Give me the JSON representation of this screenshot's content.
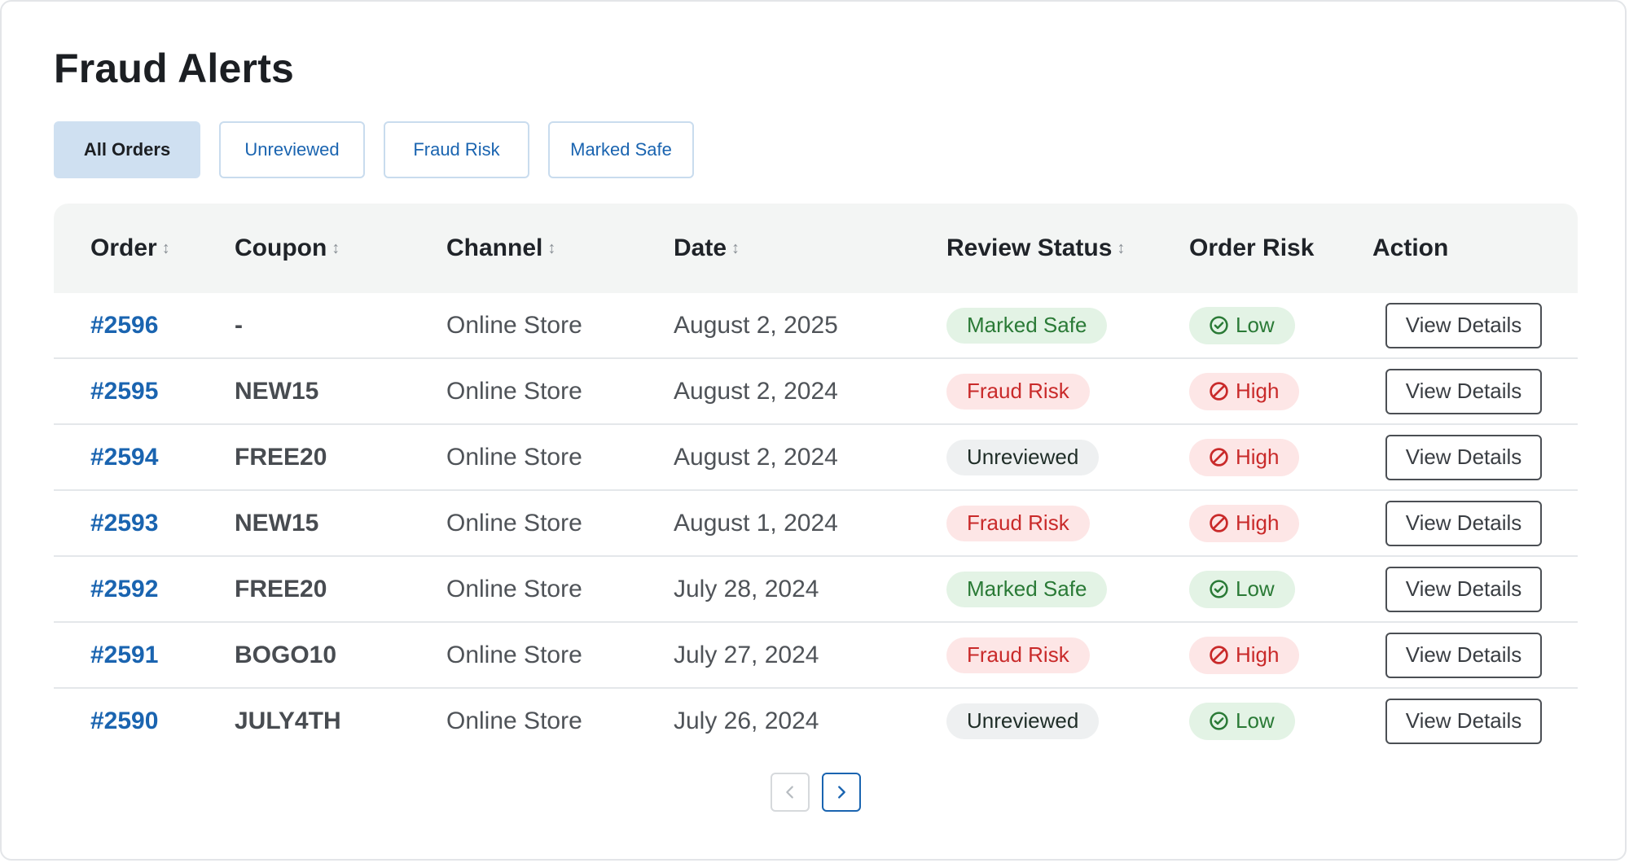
{
  "title": "Fraud Alerts",
  "tabs": [
    {
      "label": "All Orders",
      "active": true
    },
    {
      "label": "Unreviewed",
      "active": false
    },
    {
      "label": "Fraud Risk",
      "active": false
    },
    {
      "label": "Marked Safe",
      "active": false
    }
  ],
  "table": {
    "columns": [
      "Order",
      "Coupon",
      "Channel",
      "Date",
      "Review Status",
      "Order Risk",
      "Action"
    ],
    "sort_icon": "↕",
    "rows": [
      {
        "order": "#2596",
        "coupon": "-",
        "channel": "Online Store",
        "date": "August 2, 2025",
        "status": "Marked Safe",
        "risk": "Low",
        "action": "View Details"
      },
      {
        "order": "#2595",
        "coupon": "NEW15",
        "channel": "Online Store",
        "date": "August 2, 2024",
        "status": "Fraud Risk",
        "risk": "High",
        "action": "View Details"
      },
      {
        "order": "#2594",
        "coupon": "FREE20",
        "channel": "Online Store",
        "date": "August 2, 2024",
        "status": "Unreviewed",
        "risk": "High",
        "action": "View Details"
      },
      {
        "order": "#2593",
        "coupon": "NEW15",
        "channel": "Online Store",
        "date": "August 1, 2024",
        "status": "Fraud Risk",
        "risk": "High",
        "action": "View Details"
      },
      {
        "order": "#2592",
        "coupon": "FREE20",
        "channel": "Online Store",
        "date": "July 28, 2024",
        "status": "Marked Safe",
        "risk": "Low",
        "action": "View Details"
      },
      {
        "order": "#2591",
        "coupon": "BOGO10",
        "channel": "Online Store",
        "date": "July 27, 2024",
        "status": "Fraud Risk",
        "risk": "High",
        "action": "View Details"
      },
      {
        "order": "#2590",
        "coupon": "JULY4TH",
        "channel": "Online Store",
        "date": "July 26, 2024",
        "status": "Unreviewed",
        "risk": "Low",
        "action": "View Details"
      }
    ]
  },
  "colors": {
    "accent": "#1a64b0",
    "safe_bg": "#e3f3e5",
    "safe_text": "#2a7a36",
    "fraud_bg": "#fde6e6",
    "fraud_text": "#c92a2a",
    "unreviewed_bg": "#eef0f1"
  },
  "icons": {
    "low_risk": "check-circle-icon",
    "high_risk": "prohibited-icon",
    "prev_page": "chevron-left-icon",
    "next_page": "chevron-right-icon",
    "sort": "sort-arrows-icon"
  },
  "pagination": {
    "prev_enabled": false,
    "next_enabled": true
  }
}
